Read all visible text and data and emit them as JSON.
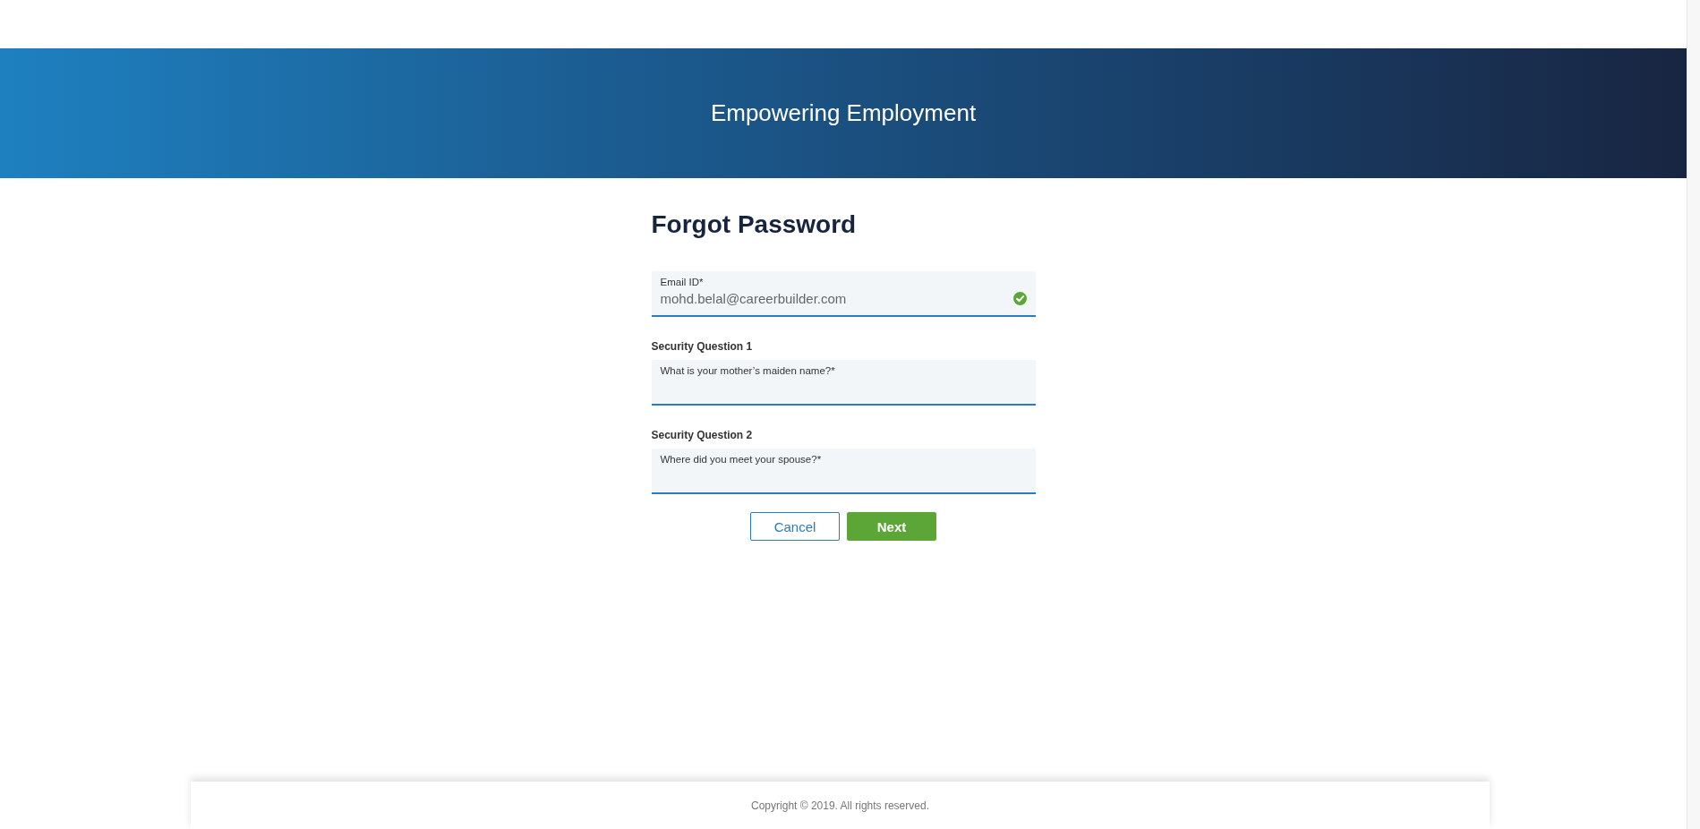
{
  "header": {
    "title": "Empowering Employment"
  },
  "form": {
    "title": "Forgot Password",
    "email": {
      "label": "Email ID*",
      "value": "mohd.belal@careerbuilder.com",
      "valid": true
    },
    "questions": [
      {
        "heading": "Security Question 1",
        "placeholder": "What is your mother’s maiden name?*"
      },
      {
        "heading": "Security Question 2",
        "placeholder": "Where did you meet your spouse?*"
      }
    ],
    "buttons": [
      {
        "label": "Cancel",
        "kind": "secondary"
      },
      {
        "label": "Next",
        "kind": "primary"
      }
    ]
  },
  "footer": {
    "copyright": "Copyright © 2019. All rights reserved."
  }
}
